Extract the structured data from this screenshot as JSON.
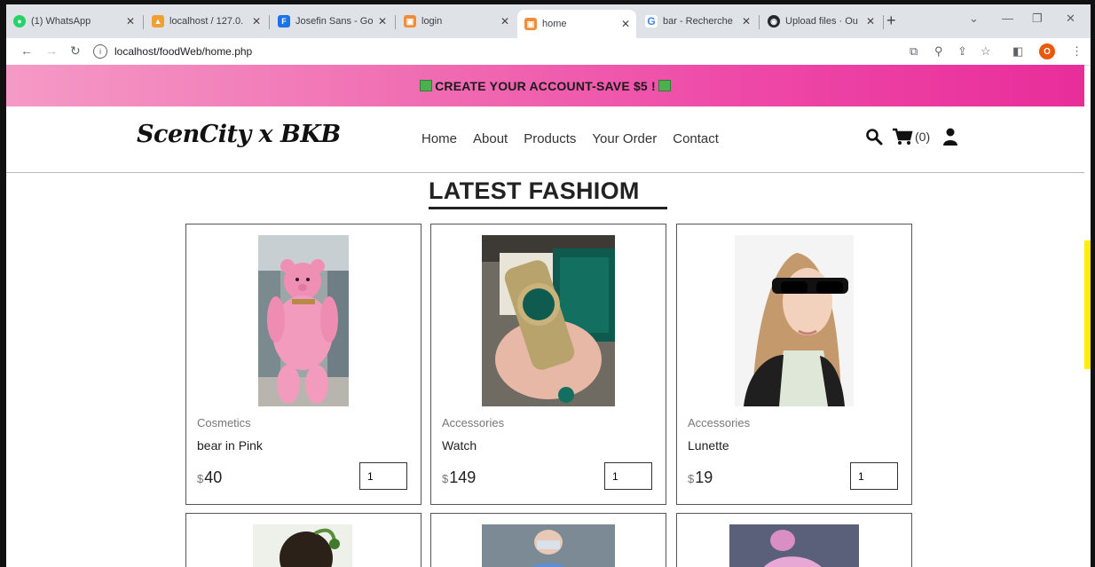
{
  "browser": {
    "tabs": [
      {
        "label": "(1) WhatsApp",
        "icon": "whatsapp-icon",
        "color": "#25d366"
      },
      {
        "label": "localhost / 127.0.",
        "icon": "phpmyadmin-icon",
        "color": "#f0a030"
      },
      {
        "label": "Josefin Sans - Go",
        "icon": "google-fonts-icon",
        "color": "#1a73e8"
      },
      {
        "label": "login",
        "icon": "site-icon",
        "color": "#f08c3a"
      },
      {
        "label": "home",
        "icon": "site-icon",
        "color": "#f08c3a",
        "active": true
      },
      {
        "label": "bar - Recherche",
        "icon": "google-icon",
        "color": "#4285f4"
      },
      {
        "label": "Upload files · Ou",
        "icon": "github-icon",
        "color": "#24292e"
      }
    ],
    "url": "localhost/foodWeb/home.php",
    "profile_initial": "O"
  },
  "promo": {
    "text": "CREATE YOUR ACCOUNT-SAVE $5 !"
  },
  "header": {
    "logo": "ScenCity x BKB",
    "nav": [
      "Home",
      "About",
      "Products",
      "Your Order",
      "Contact"
    ],
    "cart_count": "(0)"
  },
  "section": {
    "title": "LATEST FASHIOM"
  },
  "products": [
    {
      "category": "Cosmetics",
      "name": "bear in Pink",
      "currency": "$",
      "price": "40",
      "qty": "1"
    },
    {
      "category": "Accessories",
      "name": "Watch",
      "currency": "$",
      "price": "149",
      "qty": "1"
    },
    {
      "category": "Accessories",
      "name": "Lunette",
      "currency": "$",
      "price": "19",
      "qty": "1"
    }
  ],
  "colors": {
    "promo_start": "#f59ac6",
    "promo_end": "#e82d9a",
    "scroll_marker": "#ffee00"
  }
}
